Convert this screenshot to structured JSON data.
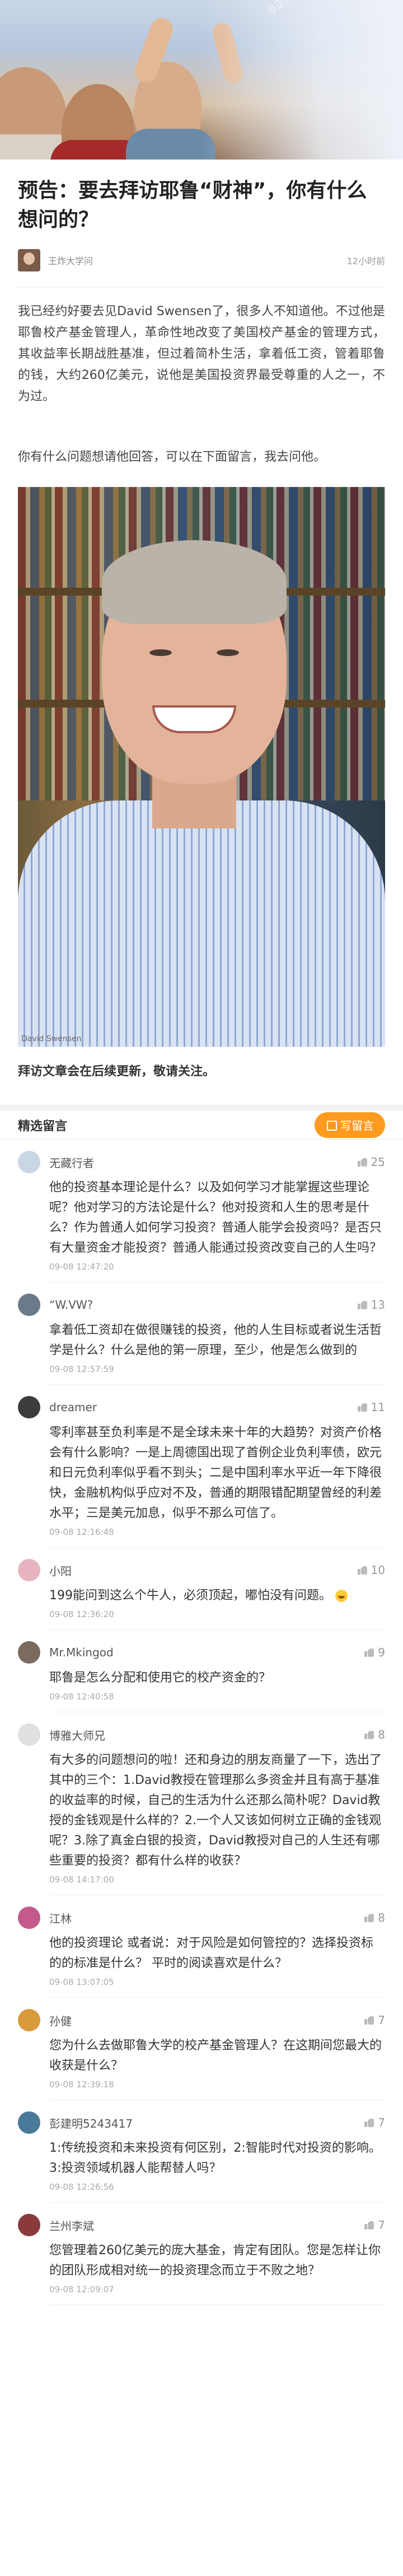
{
  "hero": {
    "watermark": "@王炸大学问"
  },
  "article": {
    "title": "预告：要去拜访耶鲁“财神”，你有什么想问的？",
    "author": "王炸大学问",
    "time": "12小时前",
    "para1": "我已经约好要去见David Swensen了，很多人不知道他。不过他是耶鲁校产基金管理人，革命性地改变了美国校产基金的管理方式，其收益率长期战胜基准，但过着简朴生活，拿着低工资，管着耶鲁的钱，大约260亿美元，说他是美国投资界最受尊重的人之一，不为过。",
    "para2": "你有什么问题想请他回答，可以在下面留言，我去问他。",
    "photo_caption": "David Swensen",
    "follow": "拜访文章会在后续更新，敬请关注。"
  },
  "comments_header": {
    "label": "精选留言",
    "write_label": "写留言"
  },
  "comments": [
    {
      "name": "无藏行者",
      "likes": "25",
      "text": "他的投资基本理论是什么？以及如何学习才能掌握这些理论呢？他对学习的方法论是什么？他对投资和人生的思考是什么？作为普通人如何学习投资？普通人能学会投资吗？是否只有大量资金才能投资？普通人能通过投资改变自己的人生吗？",
      "time": "09-08 12:47:20",
      "color": "#c9d6e3"
    },
    {
      "name": "“W.VW?",
      "likes": "13",
      "text": "拿着低工资却在做很赚钱的投资，他的人生目标或者说生活哲学是什么？什么是他的第一原理，至少，他是怎么做到的",
      "time": "09-08 12:57:59",
      "color": "#6a7a8a"
    },
    {
      "name": "dreamer",
      "likes": "11",
      "text": "零利率甚至负利率是不是全球未来十年的大趋势？对资产价格会有什么影响？一是上周德国出现了首例企业负利率债，欧元和日元负利率似乎看不到头；二是中国利率水平近一年下降很快，金融机构似乎应对不及，普通的期限错配期望曾经的利差水平；三是美元加息，似乎不那么可信了。",
      "time": "09-08 12:16:48",
      "color": "#3c3c3c"
    },
    {
      "name": "小阳",
      "likes": "10",
      "text": "199能问到这么个牛人，必须顶起，嘟怕没有问题。",
      "time": "09-08 12:36:20",
      "color": "#e8b4c0"
    },
    {
      "name": "Mr.Mkingod",
      "likes": "9",
      "text": "耶鲁是怎么分配和使用它的校产资金的？",
      "time": "09-08 12:40:58",
      "color": "#7a6a60"
    },
    {
      "name": "博雅大师兄",
      "likes": "8",
      "text": "有大多的问题想问的啦！还和身边的朋友商量了一下，选出了其中的三个：1.David教授在管理那么多资金并且有高于基准的收益率的时候，自己的生活为什么还那么简朴呢？David教授的金钱观是什么样的？2.一个人又该如何树立正确的金钱观呢？3.除了真金白银的投资，David教授对自己的人生还有哪些重要的投资？都有什么样的收获？",
      "time": "09-08 14:17:00",
      "color": "#e0e0e0"
    },
    {
      "name": "江林",
      "likes": "8",
      "text": "他的投资理论 或者说：对于风险是如何管控的？选择投资标的的标准是什么？ 平时的阅读喜欢是什么？",
      "time": "09-08 13:07:05",
      "color": "#c45a8a"
    },
    {
      "name": "孙健",
      "likes": "7",
      "text": "您为什么去做耶鲁大学的校产基金管理人？在这期间您最大的收获是什么？",
      "time": "09-08 12:39:18",
      "color": "#d89a3a"
    },
    {
      "name": "彭建明5243417",
      "likes": "7",
      "text": "1:传统投资和未来投资有何区别，2:智能时代对投资的影响。3:投资领域机器人能帮替人吗？",
      "time": "09-08 12:26:56",
      "color": "#4a7a9a"
    },
    {
      "name": "兰州李斌",
      "likes": "7",
      "text": "您管理着260亿美元的庞大基金，肯定有团队。您是怎样让你的团队形成相对统一的投资理念而立于不败之地？",
      "time": "09-08 12:09:07",
      "color": "#8a3a3a"
    }
  ]
}
